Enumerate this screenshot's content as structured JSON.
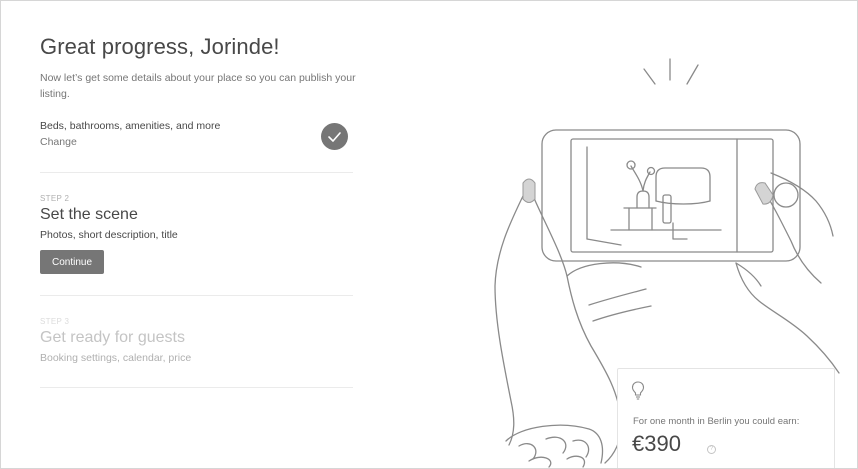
{
  "header": {
    "title": "Great progress, Jorinde!",
    "intro": "Now let’s get some details about your place so you can publish your listing."
  },
  "step1": {
    "items": "Beds, bathrooms, amenities, and more",
    "change_label": "Change",
    "status_icon": "checkmark-icon"
  },
  "step2": {
    "eyebrow": "STEP 2",
    "title": "Set the scene",
    "subtitle": "Photos, short description, title",
    "button_label": "Continue"
  },
  "step3": {
    "eyebrow": "STEP 3",
    "title": "Get ready for guests",
    "subtitle": "Booking settings, calendar, price"
  },
  "earnings": {
    "icon": "lightbulb-icon",
    "text": "For one month in Berlin you could earn:",
    "amount": "€390",
    "info_icon": "?"
  },
  "colors": {
    "text": "#484848",
    "muted": "#767676",
    "button": "#767676",
    "faint": "#c4c4c4"
  }
}
